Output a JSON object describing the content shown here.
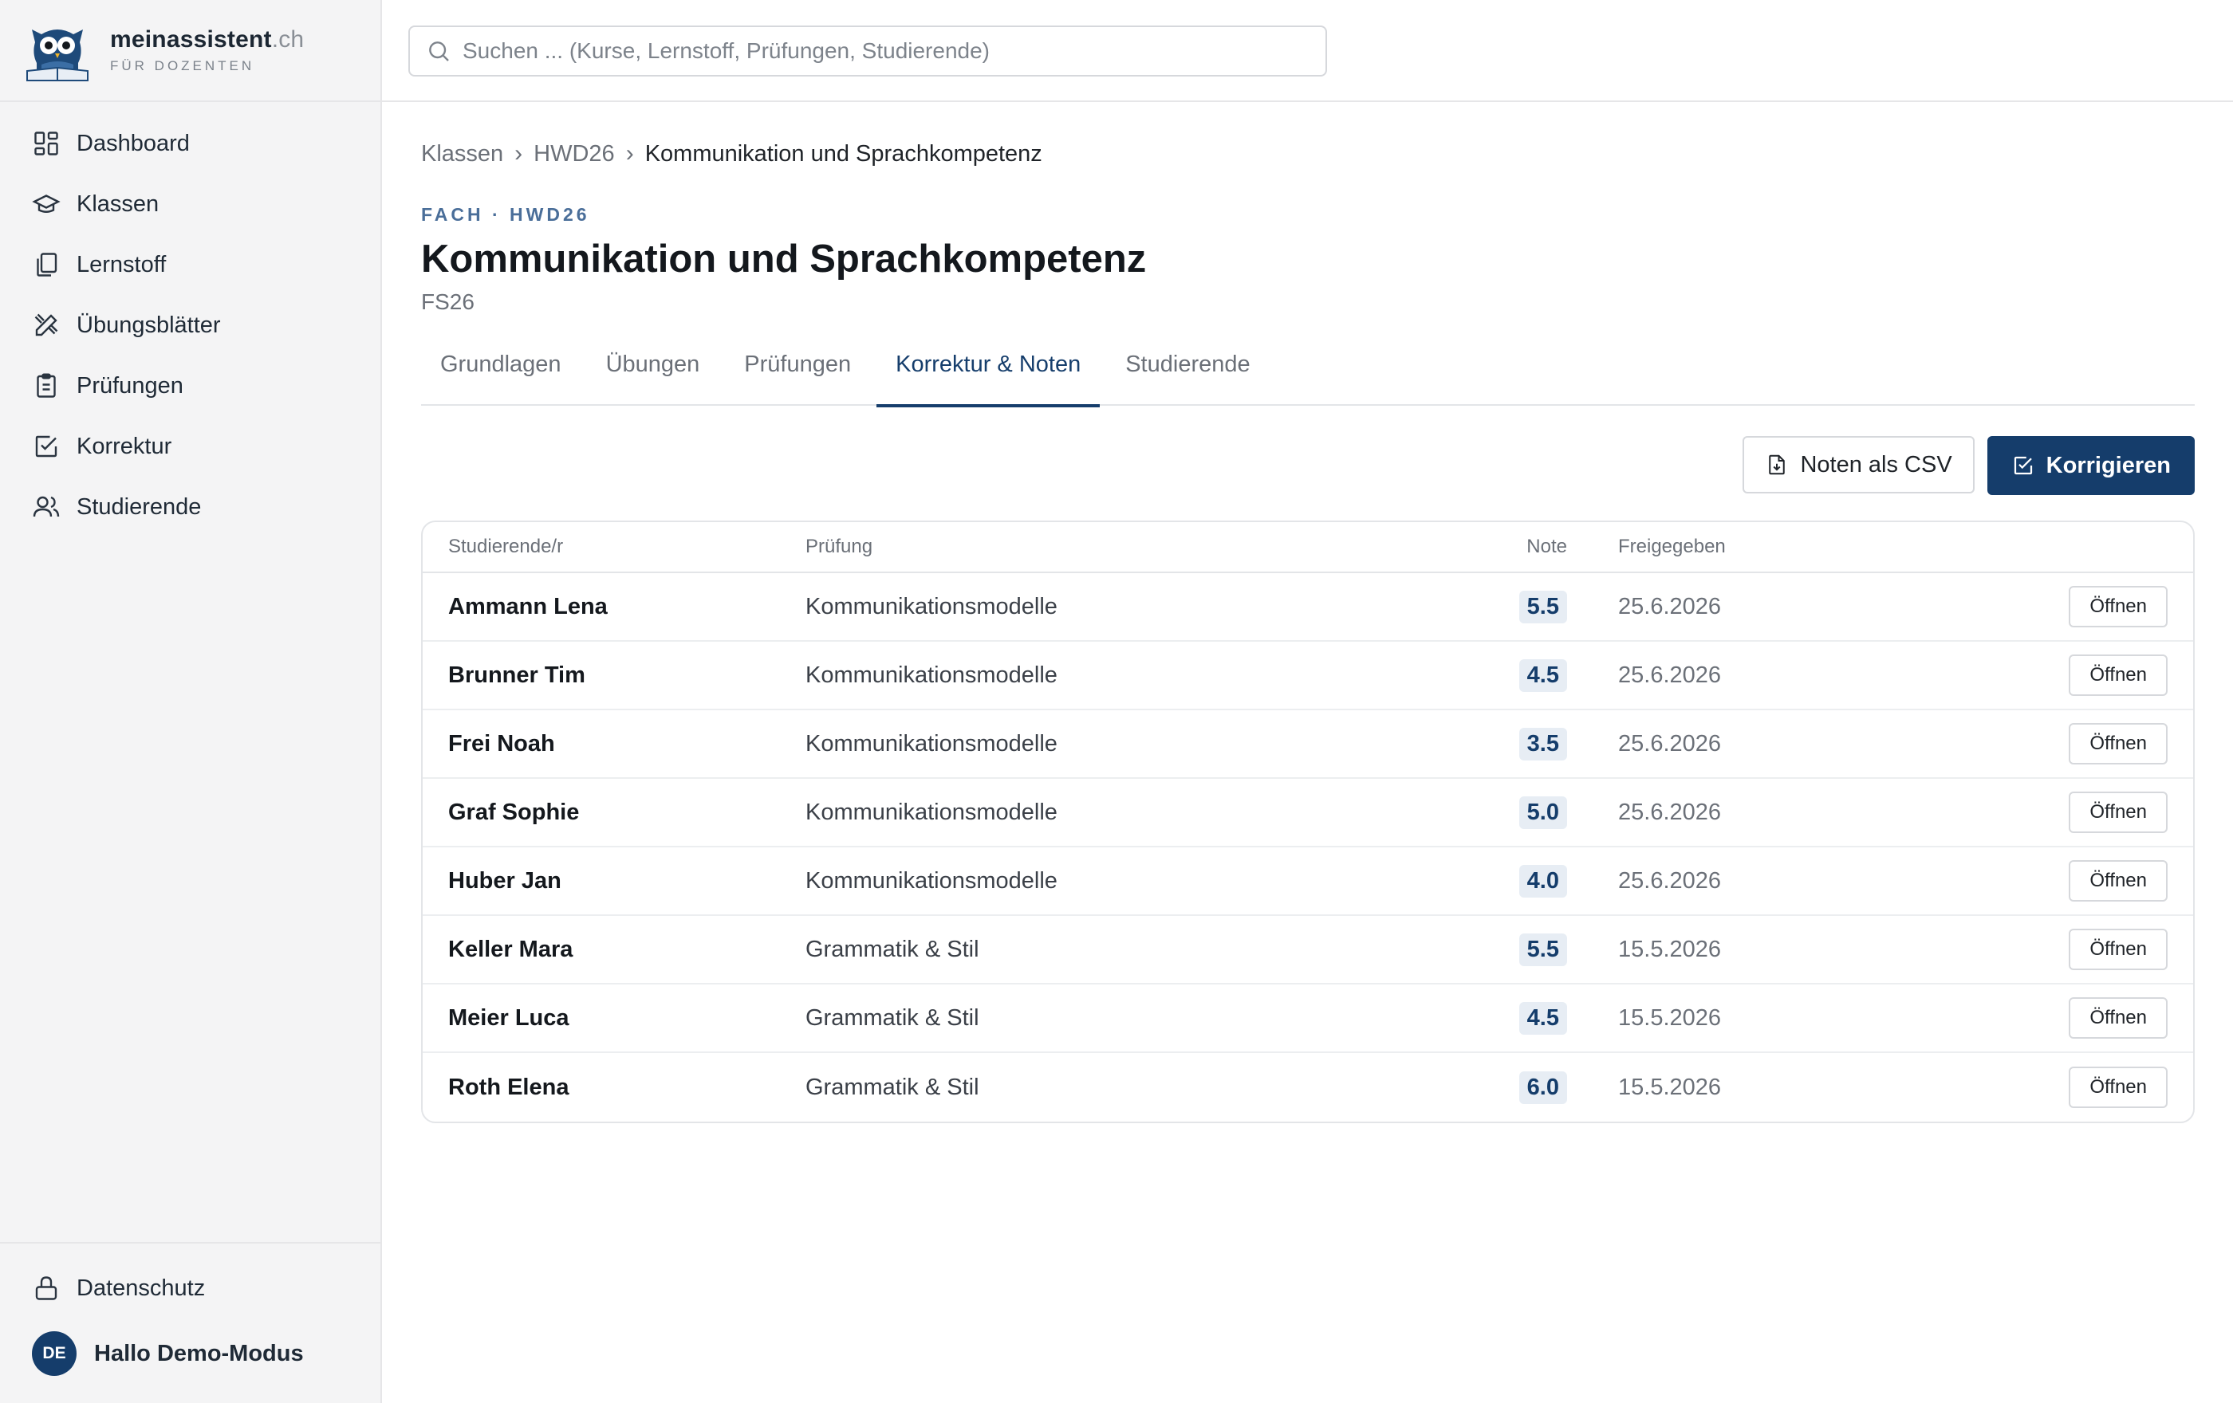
{
  "brand": {
    "name": "meinassistent",
    "tld": ".ch",
    "tagline": "FÜR DOZENTEN"
  },
  "search": {
    "placeholder": "Suchen ... (Kurse, Lernstoff, Prüfungen, Studierende)"
  },
  "sidebar": {
    "items": [
      {
        "label": "Dashboard",
        "icon": "dashboard-icon"
      },
      {
        "label": "Klassen",
        "icon": "graduation-cap-icon"
      },
      {
        "label": "Lernstoff",
        "icon": "documents-icon"
      },
      {
        "label": "Übungsblätter",
        "icon": "pencil-ruler-icon"
      },
      {
        "label": "Prüfungen",
        "icon": "clipboard-icon"
      },
      {
        "label": "Korrektur",
        "icon": "checkbox-icon"
      },
      {
        "label": "Studierende",
        "icon": "users-icon"
      }
    ],
    "privacy_label": "Datenschutz",
    "user_initials": "DE",
    "user_greeting": "Hallo Demo-Modus"
  },
  "breadcrumb": {
    "items": [
      "Klassen",
      "HWD26",
      "Kommunikation und Sprachkompetenz"
    ]
  },
  "page": {
    "eyebrow": "FACH · HWD26",
    "title": "Kommunikation und Sprachkompetenz",
    "subtitle": "FS26"
  },
  "tabs": [
    {
      "label": "Grundlagen",
      "active": false
    },
    {
      "label": "Übungen",
      "active": false
    },
    {
      "label": "Prüfungen",
      "active": false
    },
    {
      "label": "Korrektur & Noten",
      "active": true
    },
    {
      "label": "Studierende",
      "active": false
    }
  ],
  "actions": {
    "csv_label": "Noten als CSV",
    "grade_label": "Korrigieren"
  },
  "table": {
    "headers": {
      "student": "Studierende/r",
      "exam": "Prüfung",
      "grade": "Note",
      "released": "Freigegeben"
    },
    "open_label": "Öffnen",
    "rows": [
      {
        "student": "Ammann Lena",
        "exam": "Kommunikationsmodelle",
        "grade": "5.5",
        "released": "25.6.2026"
      },
      {
        "student": "Brunner Tim",
        "exam": "Kommunikationsmodelle",
        "grade": "4.5",
        "released": "25.6.2026"
      },
      {
        "student": "Frei Noah",
        "exam": "Kommunikationsmodelle",
        "grade": "3.5",
        "released": "25.6.2026"
      },
      {
        "student": "Graf Sophie",
        "exam": "Kommunikationsmodelle",
        "grade": "5.0",
        "released": "25.6.2026"
      },
      {
        "student": "Huber Jan",
        "exam": "Kommunikationsmodelle",
        "grade": "4.0",
        "released": "25.6.2026"
      },
      {
        "student": "Keller Mara",
        "exam": "Grammatik & Stil",
        "grade": "5.5",
        "released": "15.5.2026"
      },
      {
        "student": "Meier Luca",
        "exam": "Grammatik & Stil",
        "grade": "4.5",
        "released": "15.5.2026"
      },
      {
        "student": "Roth Elena",
        "exam": "Grammatik & Stil",
        "grade": "6.0",
        "released": "15.5.2026"
      }
    ]
  },
  "colors": {
    "primary": "#153d6b",
    "eyebrow": "#4a6e99",
    "grade_bg": "#e7edf4"
  }
}
